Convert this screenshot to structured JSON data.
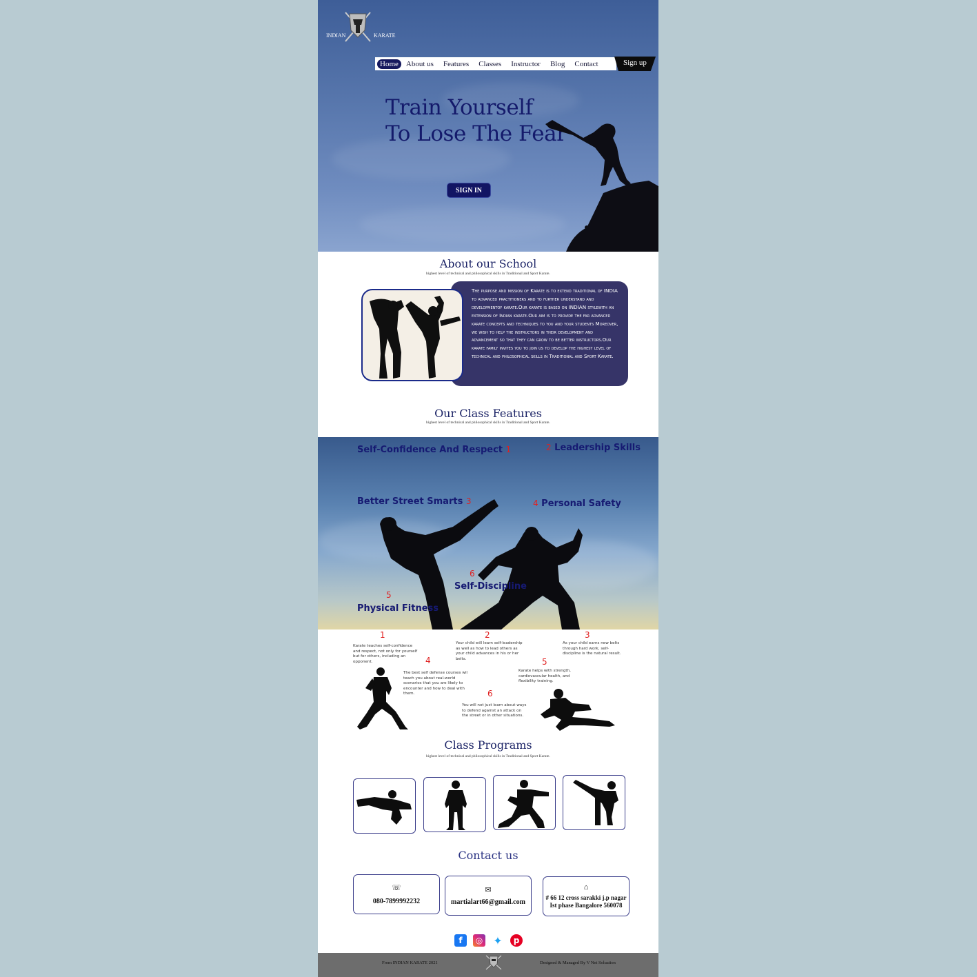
{
  "brand": {
    "left": "INDIAN",
    "right": "KARATE"
  },
  "nav": {
    "items": [
      "Home",
      "About us",
      "Features",
      "Classes",
      "Instructor",
      "Blog",
      "Contact"
    ],
    "signup": "Sign up"
  },
  "hero": {
    "title_line1": "Train Yourself",
    "title_line2": "To Lose The Fear",
    "signin": "SIGN IN"
  },
  "about": {
    "title": "About our School",
    "subtitle": "highest level of technical and philosophical skills in Traditional and Sport Karate.",
    "text": "The purpose and mission of Karate is to extend traditional of INDIA to advanced practitioners and to further understand and developmentof karate.Our karate is based on INDIAN stylewith an extension of Indian karate.Our aim is to provide the far advanced karate concepts and techniques to you and your students Moreover, we wish to help the instructors in their development and advancement so that they can grow to be better instructors.Our karate family invites you to join us to develop the highest level of technical and philosophical skills in Traditional and Sport Karate."
  },
  "features": {
    "title": "Our Class Features",
    "subtitle": "highest level of technical and philosophical skills in Traditional and Sport Karate.",
    "items": [
      {
        "label": "Self-Confidence And Respect",
        "num": "1"
      },
      {
        "label": "Leadership Skills",
        "num": "2"
      },
      {
        "label": "Better Street Smarts",
        "num": "3"
      },
      {
        "label": "Personal Safety",
        "num": "4"
      },
      {
        "label": "Physical Fitness",
        "num": "5"
      },
      {
        "label": "Self-Discipline",
        "num": "6"
      }
    ],
    "descriptions": [
      {
        "num": "1",
        "text": "Karate teaches self-confidence and respect, not only for yourself but for others, including an opponent."
      },
      {
        "num": "2",
        "text": "Your child will learn self-leadership as well as how to lead others as your child advances in his or her belts."
      },
      {
        "num": "3",
        "text": "As your child earns new belts through hard work, self-discipline is the natural result."
      },
      {
        "num": "4",
        "text": "The best self defense courses wil teach you about real-world scenarios that you are likely to encounter and how to deal with them."
      },
      {
        "num": "5",
        "text": "Karate helps with strength, cardiovascular health, and flexibility training."
      },
      {
        "num": "6",
        "text": "You will not just learn about ways to defend against an attack on the street or in other situations."
      }
    ]
  },
  "programs": {
    "title": "Class Programs",
    "subtitle": "highest level of technical and philosophical skills in Traditional and Sport Karate."
  },
  "contact": {
    "title": "Contact us",
    "phone": "080-7899992232",
    "email": "martialart66@gmail.com",
    "address_line1": "# 66 12 cross sarakki j.p nagar",
    "address_line2": "Ist phase  Bangalore 560078",
    "icons": {
      "phone": "phone-icon",
      "email": "mail-icon",
      "address": "home-icon"
    }
  },
  "social": [
    {
      "name": "facebook",
      "glyph": "f",
      "color": "#1877f2"
    },
    {
      "name": "instagram",
      "glyph": "◎",
      "color": "#d62976"
    },
    {
      "name": "twitter",
      "glyph": "✦",
      "color": "#1da1f2"
    },
    {
      "name": "pinterest",
      "glyph": "p",
      "color": "#e60023"
    }
  ],
  "footer": {
    "left": "From INDIAN KARATE 2021",
    "right": "Designed & Managed By V Net Soluation"
  }
}
